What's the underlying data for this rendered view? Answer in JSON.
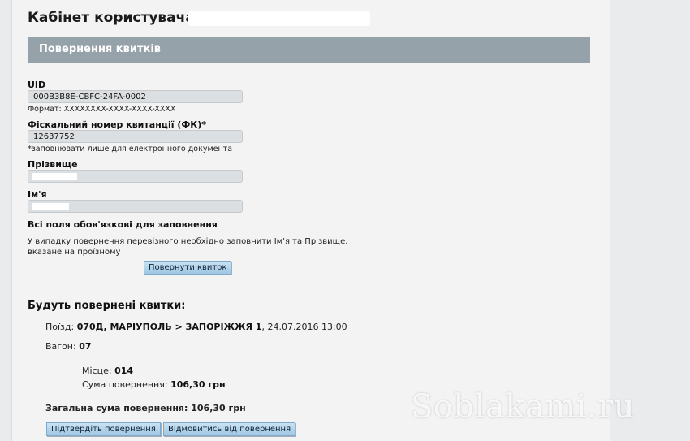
{
  "page": {
    "title": "Кабінет користувача"
  },
  "section": {
    "title": "Повернення квитків"
  },
  "form": {
    "uid": {
      "label": "UID",
      "value": "000B3B8E-CBFC-24FA-0002",
      "format_hint": "Формат: XXXXXXXX-XXXX-XXXX-XXXX"
    },
    "fiscal": {
      "label": "Фіскальний номер квитанції (ФК)*",
      "value": "12637752",
      "hint": "*заповнювати лише для електронного документа"
    },
    "surname": {
      "label": "Прізвище",
      "value": ""
    },
    "name": {
      "label": "Ім'я",
      "value": ""
    },
    "required_note": "Всі поля обов'язкові для заповнення",
    "info_text": "У випадку повернення перевізного необхідно заповнити Ім'я та Прізвище, вказане на проїзному",
    "submit_label": "Повернути квиток"
  },
  "returns": {
    "title": "Будуть повернені квитки:",
    "train_label": "Поїзд:",
    "train_route": "070Д, МАРІУПОЛЬ > ЗАПОРІЖЖЯ 1",
    "train_datetime": ", 24.07.2016 13:00",
    "wagon_label": "Вагон:",
    "wagon_value": "07",
    "seat_label": "Місце:",
    "seat_value": "014",
    "sum_label": "Сума повернення:",
    "sum_value": "106,30 грн",
    "total_label": "Загальна сума повернення:",
    "total_value": "106,30 грн",
    "confirm_label": "Підтвердіть повернення",
    "decline_label": "Відмовитись від повернення"
  },
  "watermark": "Soblakami.ru"
}
